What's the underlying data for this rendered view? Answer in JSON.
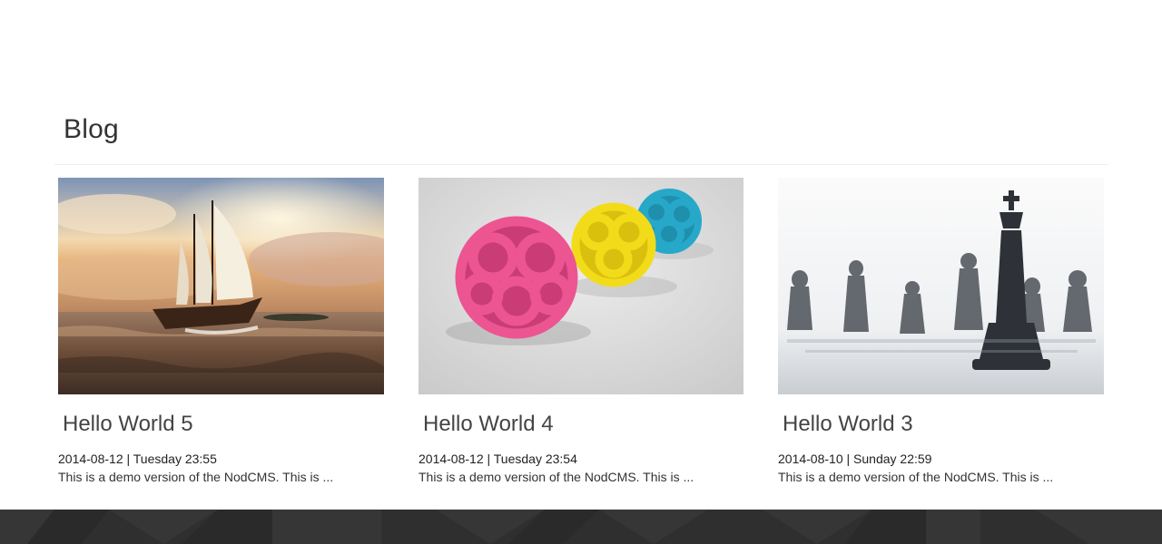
{
  "blog": {
    "title": "Blog",
    "posts": [
      {
        "title": "Hello World 5",
        "date": "2014-08-12 | Tuesday 23:55",
        "excerpt": "This is a demo version of the NodCMS. This is ...",
        "image": "sailing-ship-image"
      },
      {
        "title": "Hello World 4",
        "date": "2014-08-12 | Tuesday 23:54",
        "excerpt": "This is a demo version of the NodCMS. This is ...",
        "image": "knotted-spheres-image"
      },
      {
        "title": "Hello World 3",
        "date": "2014-08-10 | Sunday 22:59",
        "excerpt": "This is a demo version of the NodCMS. This is ...",
        "image": "chess-pieces-image"
      }
    ]
  },
  "colors": {
    "footer": "#2f2f2f",
    "divider": "#eeeeee",
    "title": "#444444"
  }
}
